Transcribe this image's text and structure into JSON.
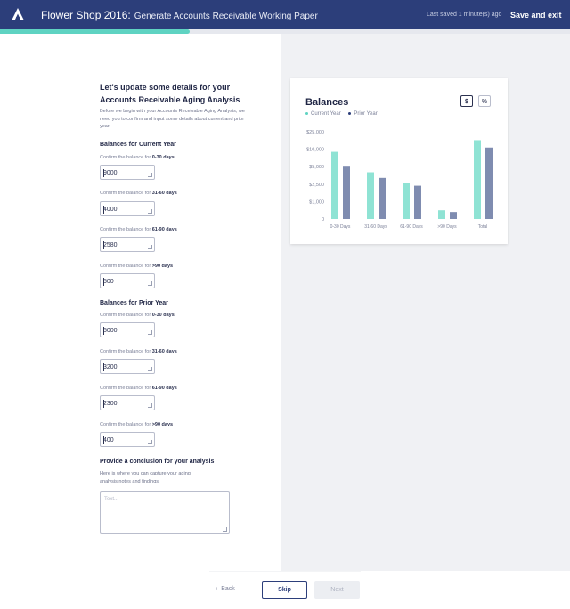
{
  "header": {
    "app_name": "Flower Shop 2016:",
    "task_title": "Generate Accounts Receivable Working Paper",
    "last_saved": "Last saved 1 minute(s) ago",
    "save_exit_label": "Save and exit"
  },
  "progress": {
    "fraction": 0.333,
    "color": "#5fd3c2"
  },
  "form": {
    "heading": "Let's update some details for your Accounts Receivable Aging Analysis",
    "intro": "Before we begin with your Accounts Receivable Aging Analysis, we need you to confirm and input some details about current and prior year.",
    "current_year": {
      "title": "Balances for Current Year",
      "fields": [
        {
          "prefix": "Confirm the balance for ",
          "period": "0-30 days",
          "value": "9000"
        },
        {
          "prefix": "Confirm the balance for ",
          "period": "31-60 days",
          "value": "4000"
        },
        {
          "prefix": "Confirm the balance for ",
          "period": "61-90 days",
          "value": "2580"
        },
        {
          "prefix": "Confirm the balance for ",
          "period": ">90 days",
          "value": "500"
        }
      ]
    },
    "prior_year": {
      "title": "Balances for Prior Year",
      "fields": [
        {
          "prefix": "Confirm the balance for ",
          "period": "0-30 days",
          "value": "5000"
        },
        {
          "prefix": "Confirm the balance for ",
          "period": "31-60 days",
          "value": "3200"
        },
        {
          "prefix": "Confirm the balance for ",
          "period": "61-90 days",
          "value": "2300"
        },
        {
          "prefix": "Confirm the balance for ",
          "period": ">90 days",
          "value": "400"
        }
      ]
    },
    "conclusion": {
      "title": "Provide a conclusion for your analysis",
      "help": "Here is where you can capture your aging analysis notes and findings.",
      "placeholder": "Text..."
    }
  },
  "chart_panel": {
    "title": "Balances",
    "unit_dollar": "$",
    "unit_percent": "%",
    "active_unit": "$"
  },
  "colors": {
    "header_bg": "#2c3e7a",
    "current_year": "#8fe3d4",
    "prior_year": "#7f8cb0"
  },
  "chart_data": {
    "type": "bar",
    "categories": [
      "0-30 Days",
      "31-60 Days",
      "61-90 Days",
      ">90 Days",
      "Total"
    ],
    "series": [
      {
        "name": "Current Year",
        "values": [
          9000,
          4000,
          2580,
          500,
          16080
        ]
      },
      {
        "name": "Prior Year",
        "values": [
          5000,
          3200,
          2300,
          400,
          10900
        ]
      }
    ],
    "yticks": [
      0,
      1000,
      2500,
      5000,
      10000,
      25000
    ],
    "ytick_labels": [
      "0",
      "$1,000",
      "$2,500",
      "$5,000",
      "$10,000",
      "$25,000"
    ],
    "y_scale": "log",
    "legend_position": "top-left"
  },
  "footer": {
    "back_label": "Back",
    "skip_label": "Skip",
    "next_label": "Next"
  }
}
